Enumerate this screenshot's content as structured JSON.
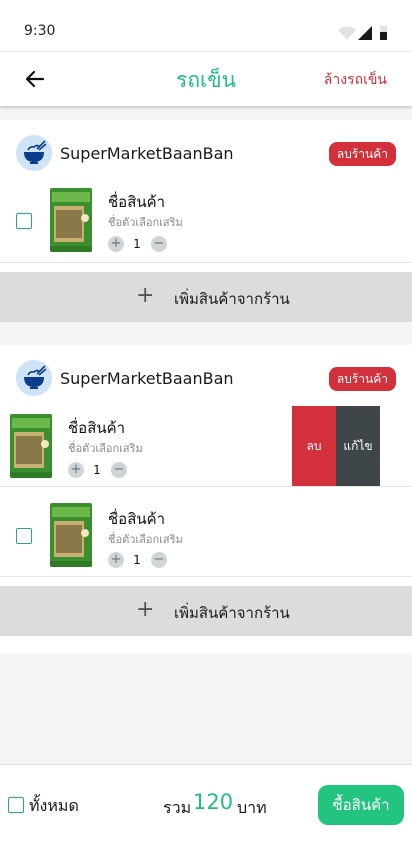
{
  "status_bar": {
    "time": "9:30"
  },
  "header": {
    "title": "รถเข็น",
    "clear_label": "ล้างรถเข็น"
  },
  "shops": [
    {
      "name": "SuperMarketBaanBan",
      "remove_label": "ลบร้านค้า",
      "items": [
        {
          "name": "ชื่อสินค้า",
          "option": "ชื่อตัวเลือกเสริม",
          "qty": "1",
          "checked": false
        }
      ],
      "add_label": "เพิ่มสินค้าจากร้าน"
    },
    {
      "name": "SuperMarketBaanBan",
      "remove_label": "ลบร้านค้า",
      "items": [
        {
          "name": "ชื่อสินค้า",
          "option": "ชื่อตัวเลือกเสริม",
          "qty": "1",
          "swipe_delete": "ลบ",
          "swipe_edit": "แก้ไข"
        },
        {
          "name": "ชื่อสินค้า",
          "option": "ชื่อตัวเลือกเสริม",
          "qty": "1",
          "checked": false
        }
      ],
      "add_label": "เพิ่มสินค้าจากร้าน"
    }
  ],
  "footer": {
    "select_all_label": "ทั้งหมด",
    "total_label": "รวม",
    "total_value": "120",
    "currency": "บาท",
    "buy_label": "ซื้อสินค้า"
  },
  "colors": {
    "accent": "#1fbf7f",
    "danger": "#d2303a",
    "edit": "#3f4649"
  },
  "icons": {
    "back": "arrow-left-icon",
    "shop": "bowl-icon",
    "plus": "plus-icon",
    "minus": "minus-icon"
  }
}
